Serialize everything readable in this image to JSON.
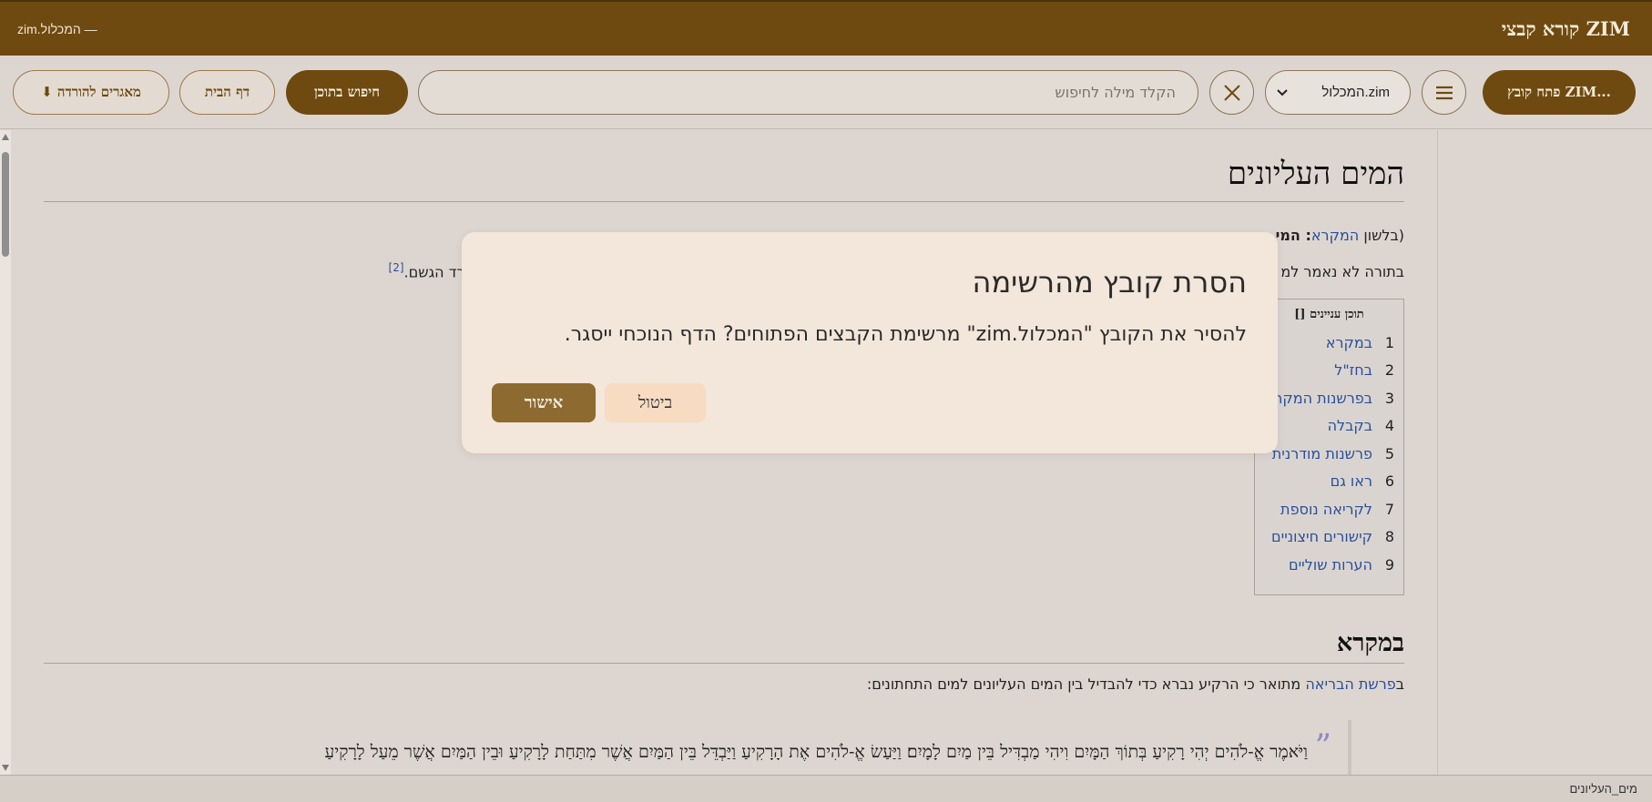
{
  "titlebar": {
    "app_title": "קורא קבצי ZIM",
    "doc_title": "zim.המכלול —"
  },
  "toolbar": {
    "open_zim_label": "פתח קובץ ZIM...",
    "menu_icon": "hamburger-icon",
    "file_select_value": "המכלול.zim",
    "clear_icon": "close-icon",
    "search_placeholder": "הקלד מילה לחיפוש",
    "search_content_label": "חיפוש בתוכן",
    "home_label": "דף הבית",
    "download_repos_label": "⬇ מאגרים להורדה"
  },
  "article": {
    "title": "המים העליונים",
    "para1_prefix": "(בלשון ",
    "para1_link": "המקרא",
    "para1_rest": ": המי",
    "para2_text": "בתורה לא נאמר למ",
    "para2_right": "קיע קיים מאגר מים שממנו יורד הגשם.",
    "para2_ref": "[2]",
    "toc": {
      "title": "תוכן עניינים []",
      "items": [
        {
          "num": "1",
          "label": "במקרא"
        },
        {
          "num": "2",
          "label": "בחז\"ל"
        },
        {
          "num": "3",
          "label": "בפרשנות המקרא"
        },
        {
          "num": "4",
          "label": "בקבלה"
        },
        {
          "num": "5",
          "label": "פרשנות מודרנית"
        },
        {
          "num": "6",
          "label": "ראו גם"
        },
        {
          "num": "7",
          "label": "לקריאה נוספת"
        },
        {
          "num": "8",
          "label": "קישורים חיצוניים"
        },
        {
          "num": "9",
          "label": "הערות שוליים"
        }
      ]
    },
    "section_title": "במקרא",
    "section_para_prefix": "ב",
    "section_para_link": "פרשת הבריאה",
    "section_para_rest": " מתואר כי הרקיע נברא כדי להבדיל בין המים העליונים למים התחתונים:",
    "quote_mark": "”",
    "quote_text": "וַיֹּאמֶר אֱ-לֹהִים יְהִי רָקִיעַ בְּתוֹךְ הַמָּיִם וִיהִי מַבְדִּיל בֵּין מַיִם לָמָיִם׃ וַיַּעַשׂ אֱ-לֹהִים אֶת הָרָקִיעַ וַיַּבְדֵּל בֵּין הַמַּיִם אֲשֶׁר מִתַּחַת לָרָקִיעַ וּבֵין הַמַּיִם אֲשֶׁר מֵעַל לָרָקִיעַ"
  },
  "statusbar": {
    "text": "מים_העליונים"
  },
  "modal": {
    "title": "הסרת קובץ מהרשימה",
    "message": "להסיר את הקובץ \"המכלול.zim\" מרשימת הקבצים הפתוחים? הדף הנוכחי ייסגר.",
    "confirm_label": "אישור",
    "cancel_label": "ביטול"
  },
  "colors": {
    "brand": "#6e4a10",
    "link": "#2a4f9a",
    "modal_bg": "#f3e6da",
    "confirm": "#8d6a30",
    "cancel": "#f7dcc2"
  }
}
